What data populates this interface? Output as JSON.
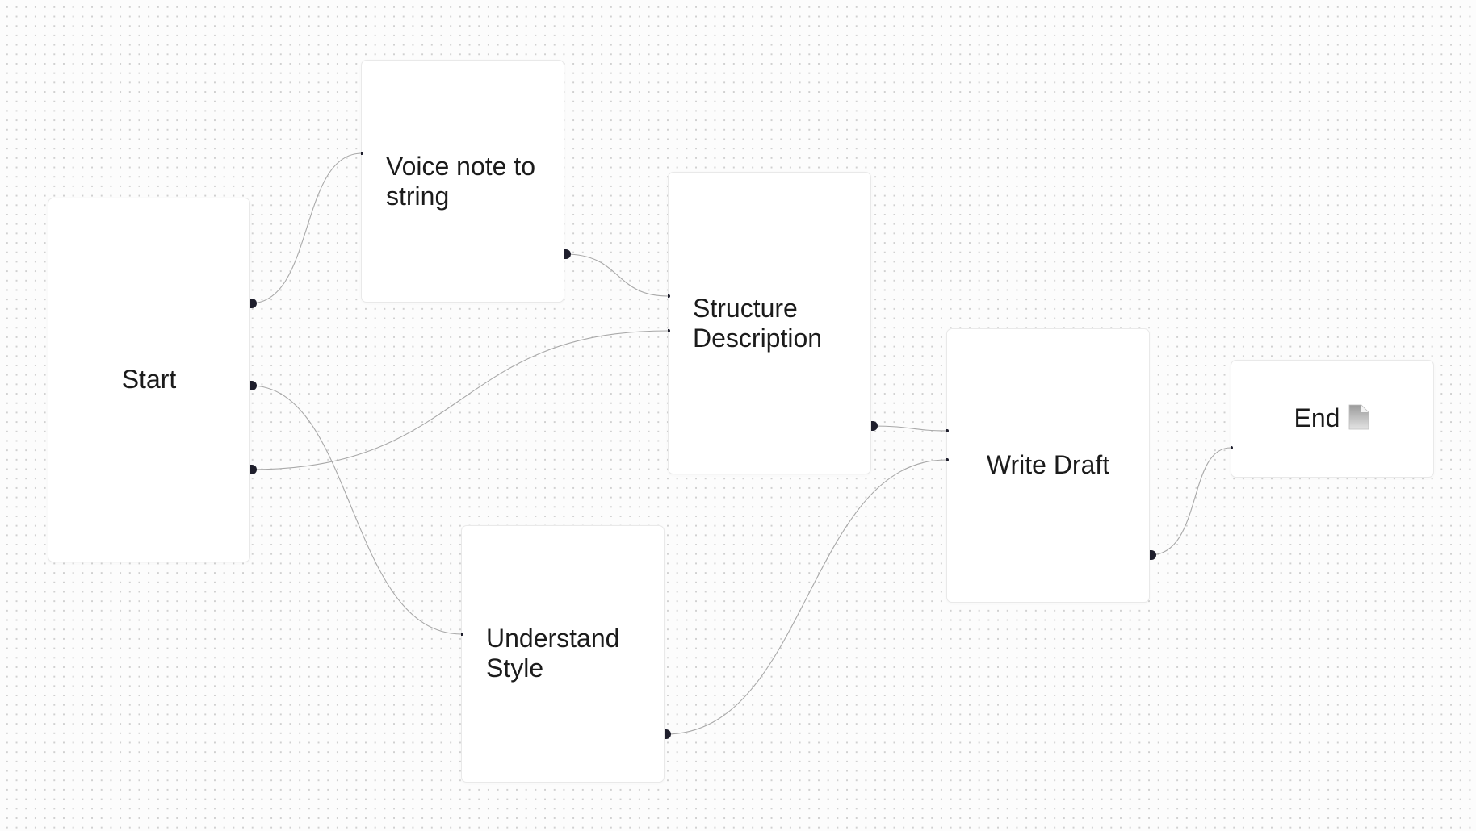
{
  "canvas": {
    "background": "#fcfcfc",
    "dot_color": "#d0d0d0",
    "edge_color": "#a8a8a8",
    "handle_color": "#1e1e2c"
  },
  "nodes": {
    "start": {
      "label": "Start"
    },
    "voice_note": {
      "label": "Voice note to string"
    },
    "structure": {
      "label": "Structure Description"
    },
    "understand_style": {
      "label": "Understand Style"
    },
    "write_draft": {
      "label": "Write Draft"
    },
    "end": {
      "label": "End",
      "icon": "document-icon"
    }
  },
  "edges": [
    {
      "from": "start",
      "to": "voice_note"
    },
    {
      "from": "start",
      "to": "understand_style"
    },
    {
      "from": "start",
      "to": "structure"
    },
    {
      "from": "voice_note",
      "to": "structure"
    },
    {
      "from": "structure",
      "to": "write_draft"
    },
    {
      "from": "understand_style",
      "to": "write_draft"
    },
    {
      "from": "write_draft",
      "to": "end"
    }
  ]
}
